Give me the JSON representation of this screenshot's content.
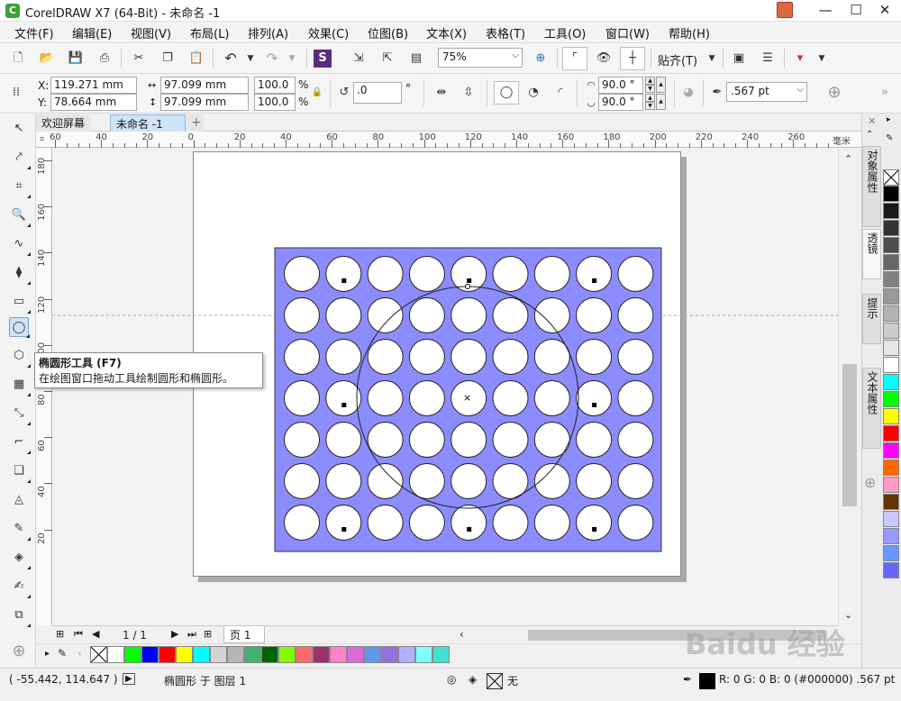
{
  "window": {
    "title": "CorelDRAW X7 (64-Bit) - 未命名 -1",
    "logo_glyph": "C"
  },
  "menu": [
    "文件(F)",
    "编辑(E)",
    "视图(V)",
    "布局(L)",
    "排列(A)",
    "效果(C)",
    "位图(B)",
    "文本(X)",
    "表格(T)",
    "工具(O)",
    "窗口(W)",
    "帮助(H)"
  ],
  "toolbar": {
    "zoom": "75%",
    "snap_label": "贴齐(T)"
  },
  "property_bar": {
    "x_label": "X:",
    "x": "119.271 mm",
    "y_label": "Y:",
    "y": "78.664 mm",
    "width": "97.099 mm",
    "height": "97.099 mm",
    "scale_x": "100.0",
    "scale_y": "100.0",
    "pct": "%",
    "rotation": ".0",
    "degree": "°",
    "start_angle": "90.0 °",
    "end_angle": "90.0 °",
    "outline_width": ".567 pt"
  },
  "tabs": {
    "welcome": "欢迎屏幕",
    "document": "未命名 -1",
    "add": "+"
  },
  "ruler": {
    "unit": "毫米",
    "top_ticks": [
      "60",
      "40",
      "20",
      "0",
      "20",
      "40",
      "60",
      "80",
      "100",
      "120",
      "140",
      "160",
      "180",
      "200",
      "220",
      "240",
      "260"
    ],
    "left_ticks": [
      "180",
      "160",
      "140",
      "120",
      "100",
      "80",
      "60",
      "40",
      "20"
    ]
  },
  "tooltip": {
    "title": "椭圆形工具 (F7)",
    "description": "在绘图窗口拖动工具绘制圆形和椭圆形。"
  },
  "page_nav": {
    "counter": "1 / 1",
    "page_tab": "页 1"
  },
  "docker_tabs": [
    "对象属性",
    "透镜",
    "提示",
    "文本属性"
  ],
  "statusbar": {
    "coords": "( -55.442, 114.647 )",
    "object_info": "椭圆形 于 图层 1",
    "fill_none": "无",
    "color_info": "R: 0 G: 0 B: 0 (#000000)  .567 pt"
  },
  "colors": {
    "grid_bg": "#8c8cff",
    "accent": "#cfe3f7"
  },
  "watermark": "Baidu 经验",
  "drawing": {
    "rows": 7,
    "cols": 9,
    "marked_cells": [
      [
        0,
        1
      ],
      [
        0,
        4
      ],
      [
        0,
        7
      ],
      [
        3,
        1
      ],
      [
        3,
        7
      ],
      [
        6,
        1
      ],
      [
        6,
        4
      ],
      [
        6,
        7
      ]
    ]
  }
}
